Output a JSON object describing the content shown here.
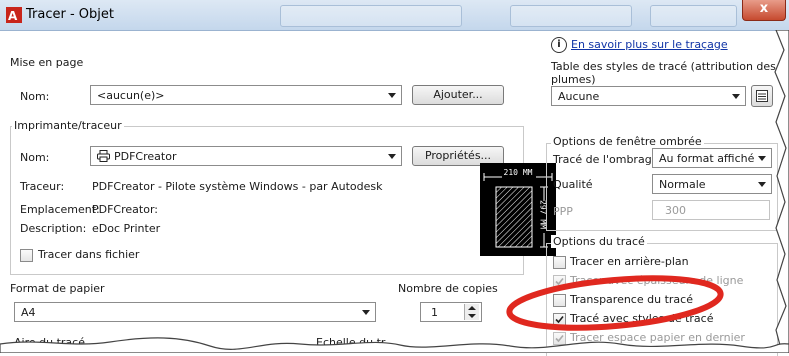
{
  "window": {
    "title": "Tracer - Objet",
    "close_glyph": "x"
  },
  "help": {
    "icon": "info-icon",
    "glyph": "i",
    "link": "En savoir plus sur le traçage"
  },
  "page_setup": {
    "label": "Mise en page",
    "name_label": "Nom:",
    "name_value": "<aucun(e)>",
    "add_button": "Ajouter..."
  },
  "printer": {
    "label": "Imprimante/traceur",
    "name_label": "Nom:",
    "name_value": "PDFCreator",
    "printer_icon": "printer-icon",
    "properties_button": "Propriétés...",
    "plotter_label": "Traceur:",
    "plotter_value": "PDFCreator - Pilote système Windows - par Autodesk",
    "location_label": "Emplacement:",
    "location_value": "PDFCreator:",
    "description_label": "Description:",
    "description_value": "eDoc Printer",
    "plot_to_file_label": "Tracer dans fichier",
    "preview": {
      "width_label": "210 MM",
      "height_label": "297 MM"
    }
  },
  "paper_size": {
    "label": "Format de papier",
    "value": "A4"
  },
  "copies": {
    "label": "Nombre de copies",
    "value": "1"
  },
  "plot_area": {
    "label": "Aire du tracé"
  },
  "plot_scale": {
    "label": "Echelle du tr"
  },
  "plot_style_table": {
    "label": "Table des styles de tracé (attribution des plumes)",
    "value": "Aucune",
    "edit_icon": "edit-table-icon"
  },
  "shaded_viewport": {
    "label": "Options de fenêtre ombrée",
    "shade_plot_label": "Tracé de l'ombrage",
    "shade_plot_value": "Au format affiché",
    "quality_label": "Qualité",
    "quality_value": "Normale",
    "dpi_label": "PPP",
    "dpi_value": "300"
  },
  "plot_options": {
    "label": "Options du tracé",
    "items": [
      {
        "label": "Tracer en arrière-plan",
        "checked": false,
        "enabled": true
      },
      {
        "label": "Tracer avec épaisseurs de ligne",
        "checked": true,
        "enabled": false
      },
      {
        "label": "Transparence du tracé",
        "checked": false,
        "enabled": true
      },
      {
        "label": "Tracé avec styles de tracé",
        "checked": true,
        "enabled": true
      },
      {
        "label": "Tracer espace papier en dernier",
        "checked": true,
        "enabled": false
      }
    ]
  },
  "annotation": {
    "shape": "red-ellipse",
    "color": "#e0281f"
  },
  "colors": {
    "title_bar": "#c4d7ec",
    "link": "#1034a6",
    "annotation": "#e0281f"
  }
}
